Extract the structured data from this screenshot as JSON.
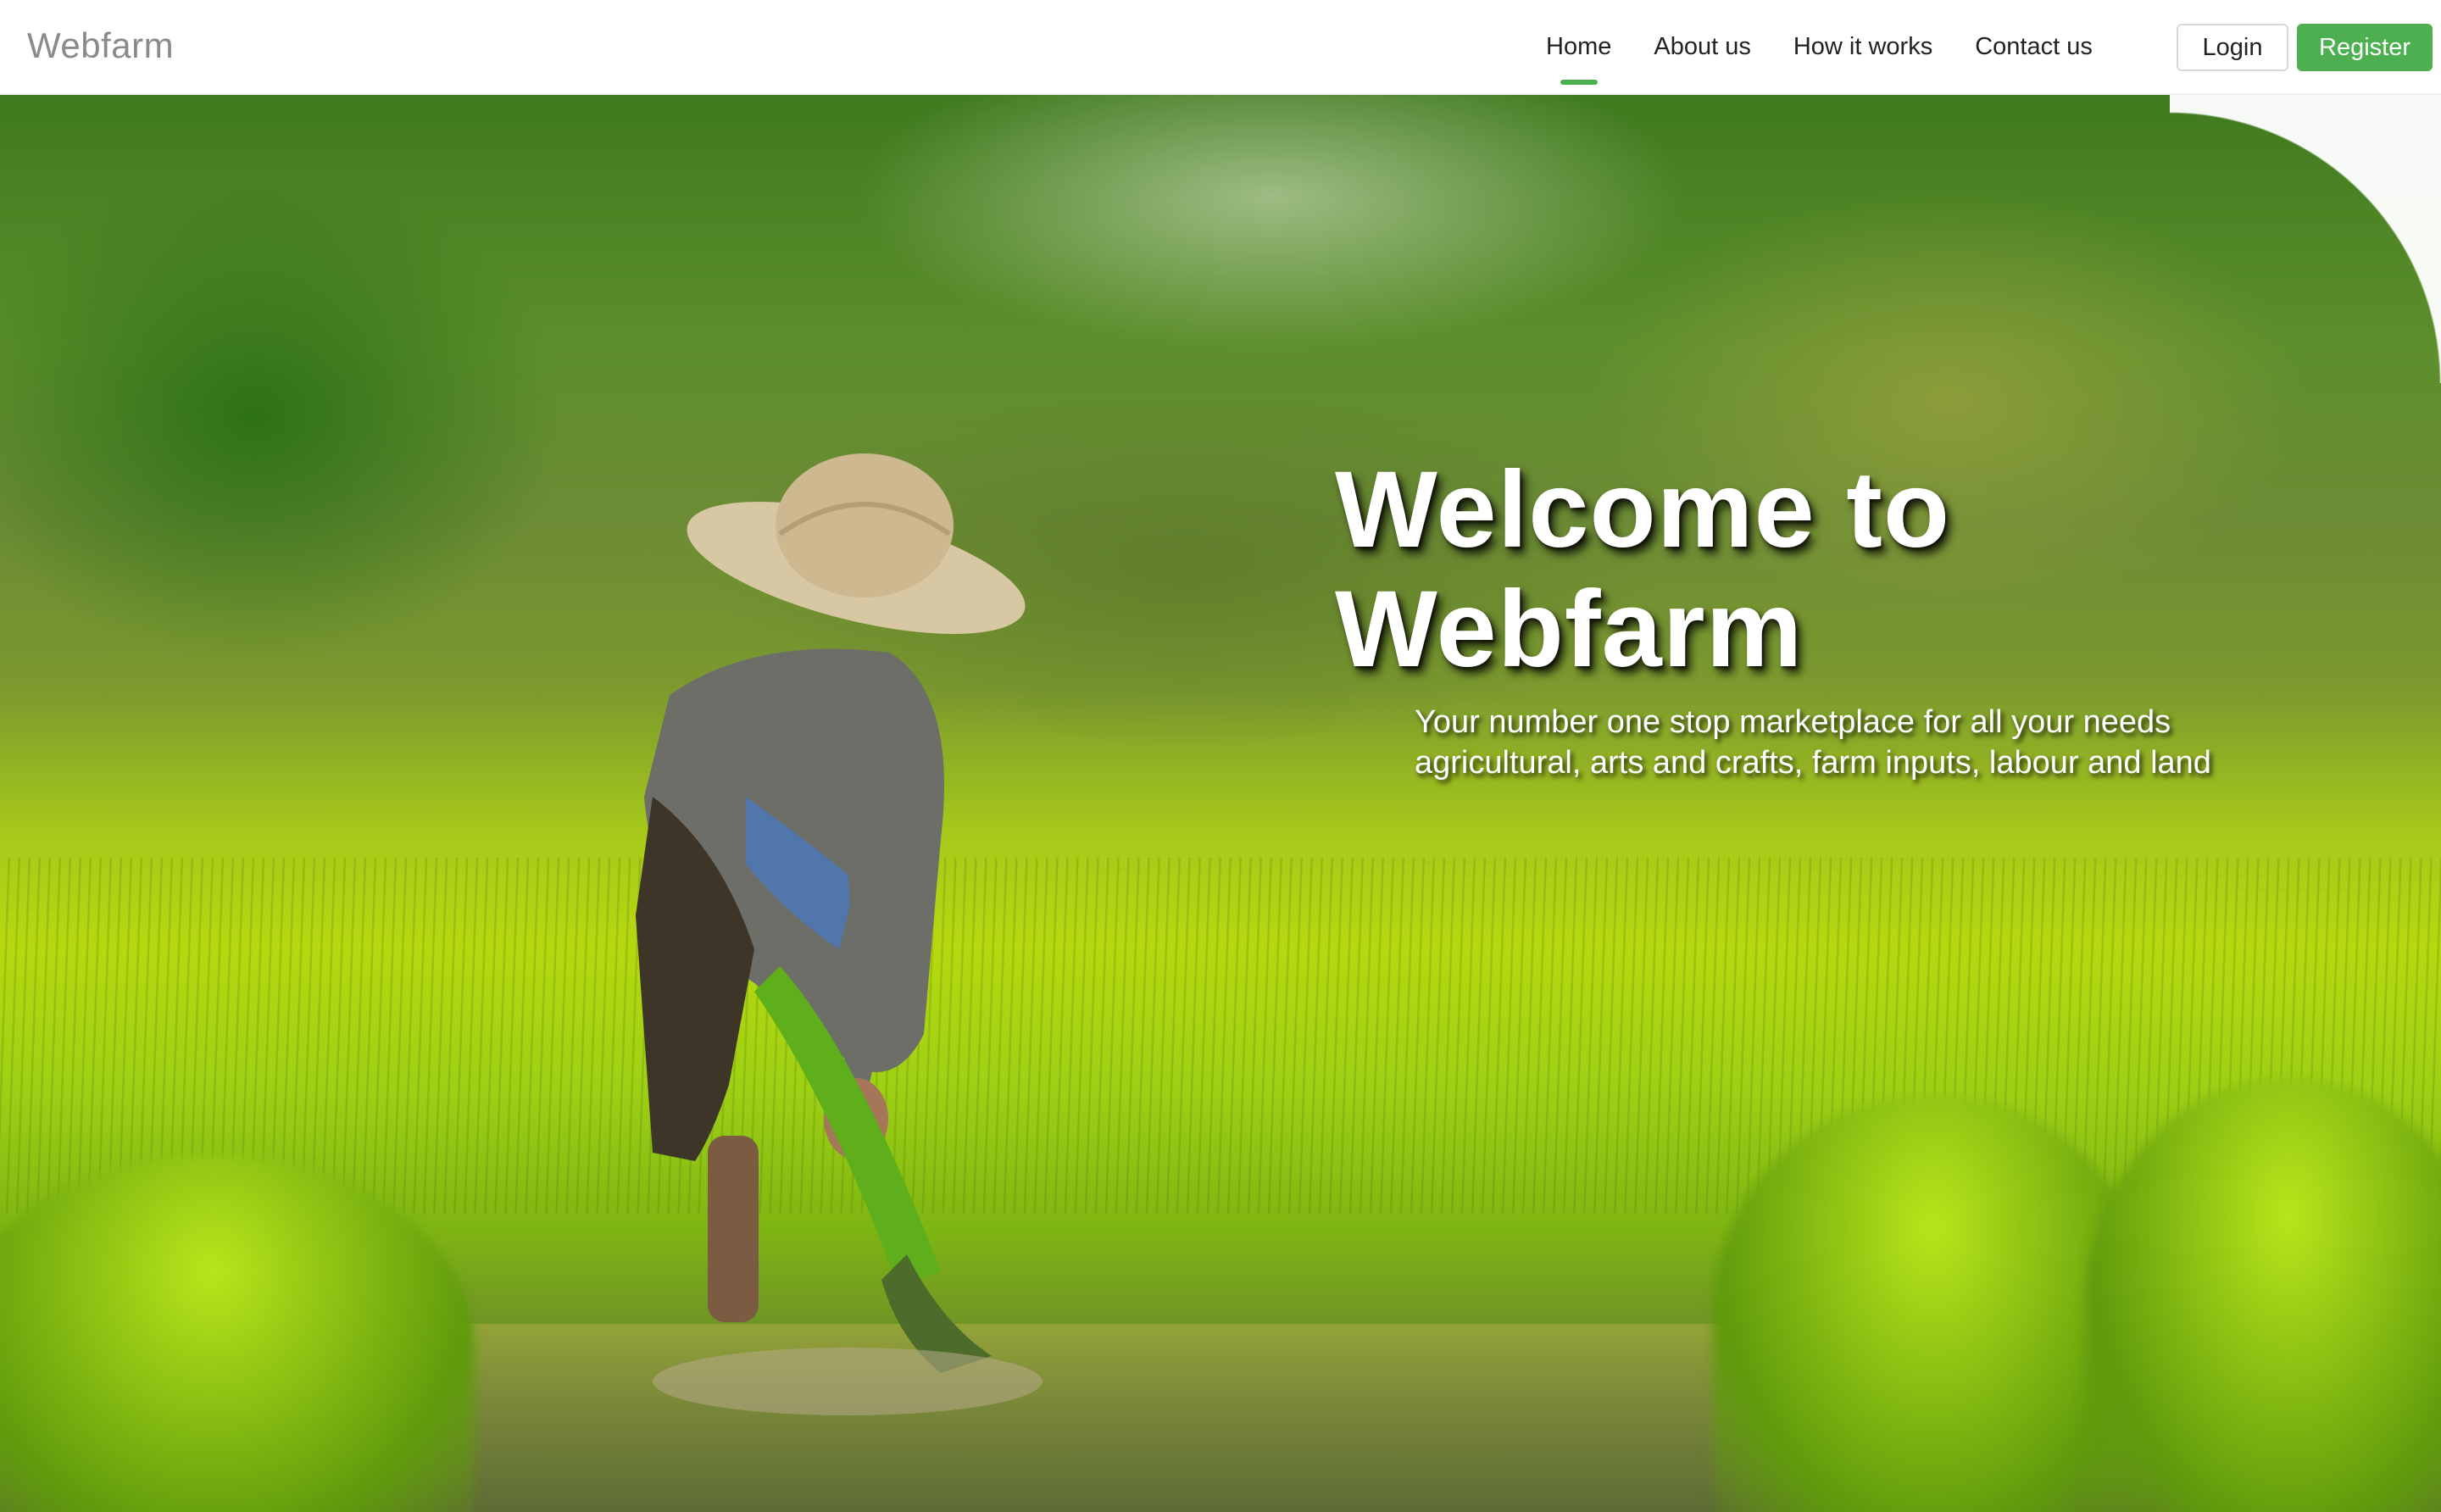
{
  "brand": {
    "name": "Webfarm"
  },
  "nav": {
    "items": [
      {
        "label": "Home",
        "active": true
      },
      {
        "label": "About us",
        "active": false
      },
      {
        "label": "How it works",
        "active": false
      },
      {
        "label": "Contact us",
        "active": false
      }
    ],
    "login_label": "Login",
    "register_label": "Register"
  },
  "hero": {
    "title": "Welcome to Webfarm",
    "subtitle_line1": "Your number one stop marketplace for all your needs",
    "subtitle_line2": "agricultural, arts and crafts, farm inputs, labour and land"
  },
  "colors": {
    "accent": "#4caf50",
    "brand_text": "#8a8a8a"
  }
}
